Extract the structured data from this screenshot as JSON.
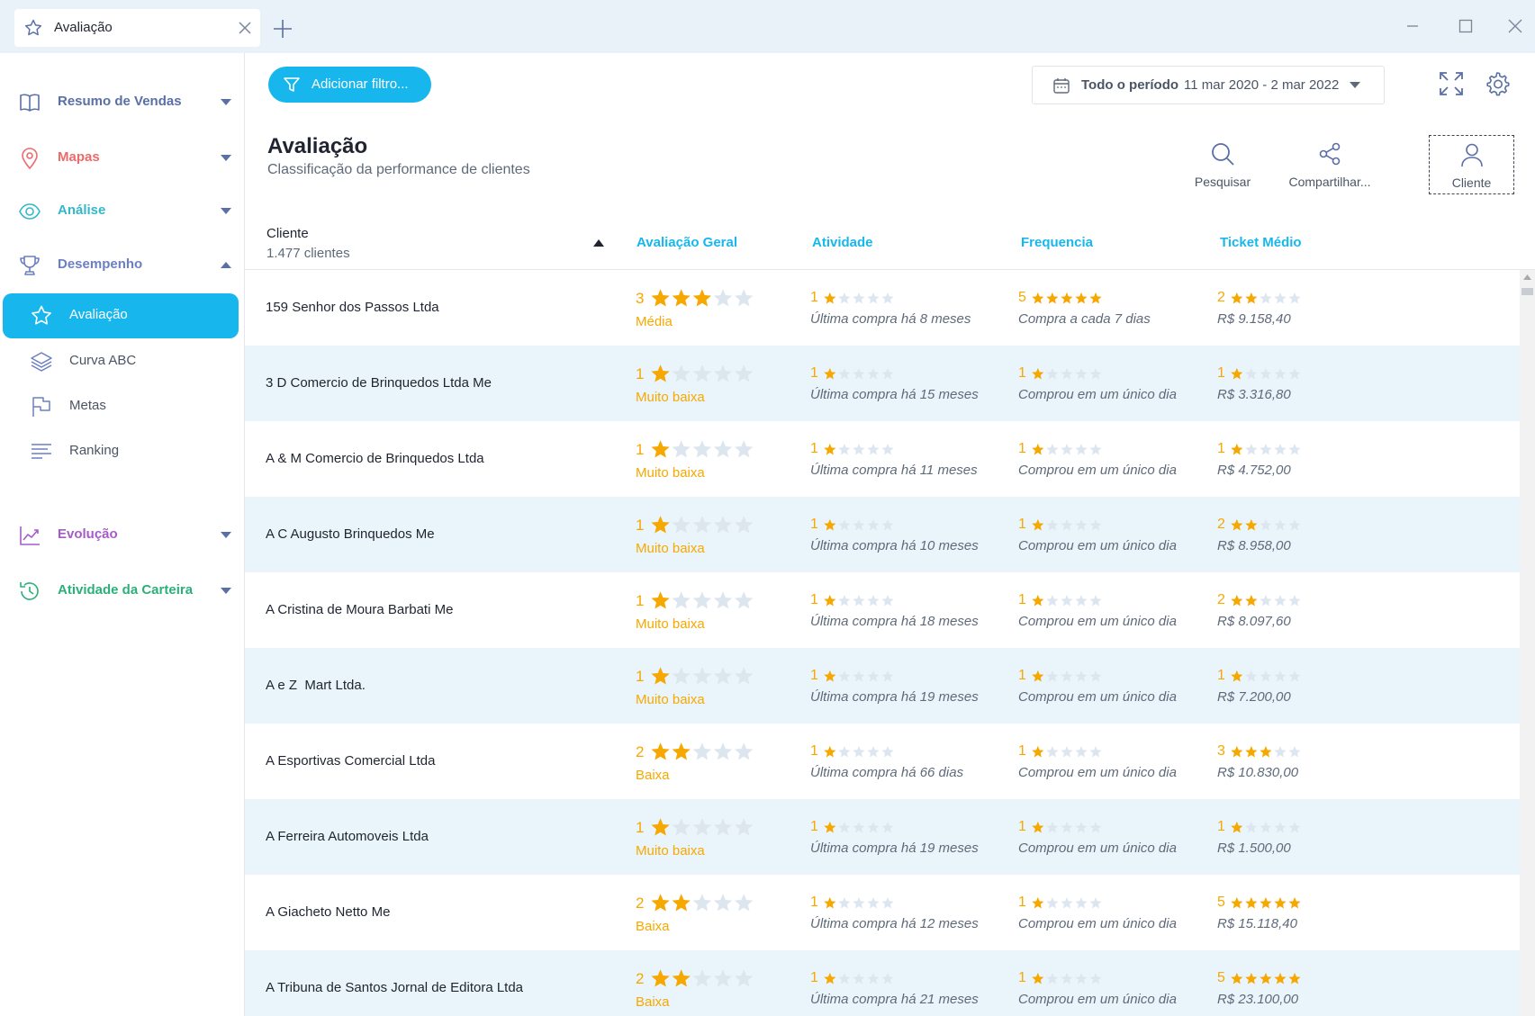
{
  "colors": {
    "accent": "#17b7ee",
    "star_filled": "#f6a800",
    "star_empty": "#dde6ef",
    "row_alt": "#eaf5fb"
  },
  "window": {
    "tab_title": "Avaliação",
    "tab_icon": "star-icon"
  },
  "sidebar": {
    "groups": [
      {
        "label": "Resumo de Vendas",
        "icon": "book-icon",
        "color": "#5a6fa6"
      },
      {
        "label": "Mapas",
        "icon": "map-pin-icon",
        "color": "#ee6a6a"
      },
      {
        "label": "Análise",
        "icon": "eye-icon",
        "color": "#35b7c9"
      },
      {
        "label": "Desempenho",
        "icon": "trophy-icon",
        "color": "#6c7fc0"
      },
      {
        "label": "Evolução",
        "icon": "trend-icon",
        "color": "#a55bc8"
      },
      {
        "label": "Atividade da Carteira",
        "icon": "history-icon",
        "color": "#2bb07a"
      }
    ],
    "sub_items": [
      {
        "label": "Avaliação",
        "icon": "star-icon",
        "active": true
      },
      {
        "label": "Curva ABC",
        "icon": "layers-icon"
      },
      {
        "label": "Metas",
        "icon": "flag-icon"
      },
      {
        "label": "Ranking",
        "icon": "list-icon"
      }
    ]
  },
  "toolbar": {
    "filter_label": "Adicionar filtro...",
    "period_label": "Todo o período",
    "period_value": "11 mar 2020 - 2 mar 2022"
  },
  "header": {
    "title": "Avaliação",
    "subtitle": "Classificação da performance de clientes",
    "actions": [
      {
        "label": "Pesquisar",
        "icon": "search-icon"
      },
      {
        "label": "Compartilhar...",
        "icon": "share-icon"
      },
      {
        "label": "Cliente",
        "icon": "user-icon"
      }
    ]
  },
  "table": {
    "client_header": "Cliente",
    "client_count": "1.477 clientes",
    "columns": [
      "Avaliação Geral",
      "Atividade",
      "Frequencia",
      "Ticket Médio"
    ],
    "rows": [
      {
        "name": "159 Senhor dos Passos Ltda",
        "overall": 3,
        "overall_label": "Média",
        "activity": 1,
        "activity_desc": "Última compra há 8 meses",
        "frequency": 5,
        "frequency_desc": "Compra a cada 7 dias",
        "ticket": 2,
        "ticket_value": "R$ 9.158,40"
      },
      {
        "name": "3 D Comercio de Brinquedos Ltda Me",
        "overall": 1,
        "overall_label": "Muito baixa",
        "activity": 1,
        "activity_desc": "Última compra há 15 meses",
        "frequency": 1,
        "frequency_desc": "Comprou em um único dia",
        "ticket": 1,
        "ticket_value": "R$ 3.316,80"
      },
      {
        "name": "A & M Comercio de Brinquedos Ltda",
        "overall": 1,
        "overall_label": "Muito baixa",
        "activity": 1,
        "activity_desc": "Última compra há 11 meses",
        "frequency": 1,
        "frequency_desc": "Comprou em um único dia",
        "ticket": 1,
        "ticket_value": "R$ 4.752,00"
      },
      {
        "name": "A C Augusto Brinquedos Me",
        "overall": 1,
        "overall_label": "Muito baixa",
        "activity": 1,
        "activity_desc": "Última compra há 10 meses",
        "frequency": 1,
        "frequency_desc": "Comprou em um único dia",
        "ticket": 2,
        "ticket_value": "R$ 8.958,00"
      },
      {
        "name": "A Cristina de Moura Barbati Me",
        "overall": 1,
        "overall_label": "Muito baixa",
        "activity": 1,
        "activity_desc": "Última compra há 18 meses",
        "frequency": 1,
        "frequency_desc": "Comprou em um único dia",
        "ticket": 2,
        "ticket_value": "R$ 8.097,60"
      },
      {
        "name": "A e Z  Mart Ltda.",
        "overall": 1,
        "overall_label": "Muito baixa",
        "activity": 1,
        "activity_desc": "Última compra há 19 meses",
        "frequency": 1,
        "frequency_desc": "Comprou em um único dia",
        "ticket": 1,
        "ticket_value": "R$ 7.200,00"
      },
      {
        "name": "A Esportivas Comercial Ltda",
        "overall": 2,
        "overall_label": "Baixa",
        "activity": 1,
        "activity_desc": "Última compra há 66 dias",
        "frequency": 1,
        "frequency_desc": "Comprou em um único dia",
        "ticket": 3,
        "ticket_value": "R$ 10.830,00"
      },
      {
        "name": "A Ferreira Automoveis Ltda",
        "overall": 1,
        "overall_label": "Muito baixa",
        "activity": 1,
        "activity_desc": "Última compra há 19 meses",
        "frequency": 1,
        "frequency_desc": "Comprou em um único dia",
        "ticket": 1,
        "ticket_value": "R$ 1.500,00"
      },
      {
        "name": "A Giacheto Netto Me",
        "overall": 2,
        "overall_label": "Baixa",
        "activity": 1,
        "activity_desc": "Última compra há 12 meses",
        "frequency": 1,
        "frequency_desc": "Comprou em um único dia",
        "ticket": 5,
        "ticket_value": "R$ 15.118,40"
      },
      {
        "name": "A Tribuna de Santos Jornal de Editora Ltda",
        "overall": 2,
        "overall_label": "Baixa",
        "activity": 1,
        "activity_desc": "Última compra há 21 meses",
        "frequency": 1,
        "frequency_desc": "Comprou em um único dia",
        "ticket": 5,
        "ticket_value": "R$ 23.100,00"
      }
    ]
  }
}
